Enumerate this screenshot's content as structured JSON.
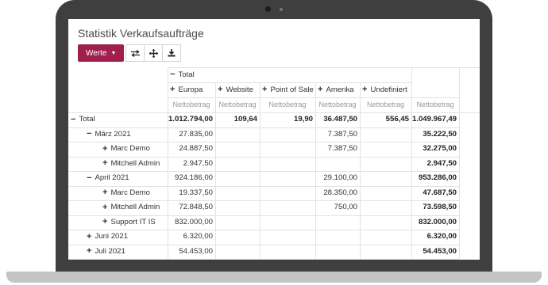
{
  "title": "Statistik Verkaufsaufträge",
  "toolbar": {
    "measures_label": "Werte",
    "icons": [
      "flip-axis-icon",
      "expand-all-icon",
      "download-icon"
    ]
  },
  "header": {
    "total_label": "Total",
    "columns": [
      "Europa",
      "Website",
      "Point of Sale",
      "Amerika",
      "Undefiniert"
    ],
    "measure_label": "Nettobetrag"
  },
  "rows": [
    {
      "label": "Total",
      "sign": "minus",
      "level": 0,
      "values": [
        "1.012.794,00",
        "109,64",
        "19,90",
        "36.487,50",
        "556,45"
      ],
      "total": "1.049.967,49"
    },
    {
      "label": "März 2021",
      "sign": "minus",
      "level": 1,
      "values": [
        "27.835,00",
        "",
        "",
        "7.387,50",
        ""
      ],
      "total": "35.222,50"
    },
    {
      "label": "Marc Demo",
      "sign": "plus",
      "level": 2,
      "values": [
        "24.887,50",
        "",
        "",
        "7.387,50",
        ""
      ],
      "total": "32.275,00"
    },
    {
      "label": "Mitchell Admin",
      "sign": "plus",
      "level": 2,
      "values": [
        "2.947,50",
        "",
        "",
        "",
        ""
      ],
      "total": "2.947,50"
    },
    {
      "label": "April 2021",
      "sign": "minus",
      "level": 1,
      "values": [
        "924.186,00",
        "",
        "",
        "29.100,00",
        ""
      ],
      "total": "953.286,00"
    },
    {
      "label": "Marc Demo",
      "sign": "plus",
      "level": 2,
      "values": [
        "19.337,50",
        "",
        "",
        "28.350,00",
        ""
      ],
      "total": "47.687,50"
    },
    {
      "label": "Mitchell Admin",
      "sign": "plus",
      "level": 2,
      "values": [
        "72.848,50",
        "",
        "",
        "750,00",
        ""
      ],
      "total": "73.598,50"
    },
    {
      "label": "Support IT IS",
      "sign": "plus",
      "level": 2,
      "values": [
        "832.000,00",
        "",
        "",
        "",
        ""
      ],
      "total": "832.000,00"
    },
    {
      "label": "Juni 2021",
      "sign": "plus",
      "level": 1,
      "values": [
        "6.320,00",
        "",
        "",
        "",
        ""
      ],
      "total": "6.320,00"
    },
    {
      "label": "Juli 2021",
      "sign": "plus",
      "level": 1,
      "values": [
        "54.453,00",
        "",
        "",
        "",
        ""
      ],
      "total": "54.453,00"
    }
  ]
}
